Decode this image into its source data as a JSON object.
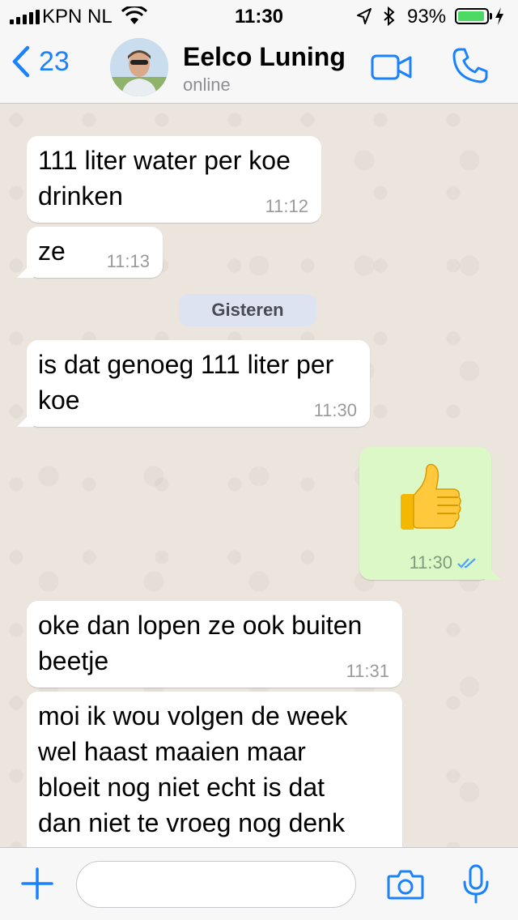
{
  "status_bar": {
    "carrier": "KPN NL",
    "time": "11:30",
    "battery_percent": "93%",
    "battery_level": 0.93,
    "icons": [
      "signal-icon",
      "wifi-icon",
      "location-arrow-icon",
      "bluetooth-icon",
      "battery-icon",
      "charging-bolt-icon"
    ]
  },
  "header": {
    "back_count": "23",
    "contact_name": "Eelco Luning",
    "contact_status": "online",
    "icons": [
      "chevron-left-icon",
      "avatar",
      "video-camera-icon",
      "phone-icon"
    ]
  },
  "messages": [
    {
      "direction": "incoming",
      "lines": [
        "111 liter water per koe",
        "drinken"
      ],
      "time": "11:12"
    },
    {
      "direction": "incoming",
      "lines": [
        "ze"
      ],
      "time": "11:13"
    },
    {
      "direction": "incoming",
      "lines": [
        "is dat genoeg 111 liter per",
        "koe"
      ],
      "time": "11:30"
    },
    {
      "direction": "outgoing",
      "emoji": "thumbs-up",
      "time": "11:30",
      "read_receipt": "double-check-blue"
    },
    {
      "direction": "incoming",
      "lines": [
        "oke dan lopen ze ook buiten",
        "beetje"
      ],
      "time": "11:31"
    },
    {
      "direction": "incoming",
      "lines": [
        "moi ik wou volgen de week",
        "wel haast maaien maar",
        "bloeit  nog niet echt is dat",
        "dan niet te vroeg nog denk"
      ]
    }
  ],
  "date_separator": "Gisteren",
  "input_bar": {
    "message_value": "",
    "icons": [
      "plus-icon",
      "camera-icon",
      "microphone-icon"
    ]
  },
  "colors": {
    "accent": "#1982FC",
    "chat_background": "#ECE5DD",
    "incoming_bubble": "#FFFFFF",
    "outgoing_bubble": "#DCF8C6",
    "read_ticks": "#4FA3F7",
    "battery": "#4CD964"
  }
}
